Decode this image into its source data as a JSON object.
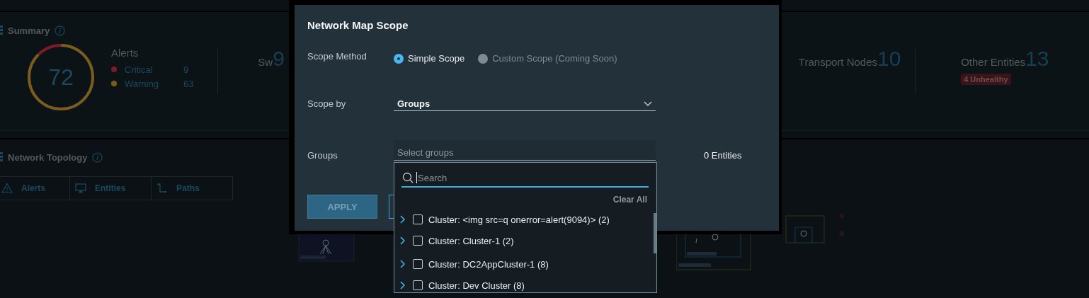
{
  "summary": {
    "title": "Summary",
    "alerts": {
      "title": "Alerts",
      "total": "72",
      "items": [
        {
          "label": "Critical",
          "count": "9",
          "color": "#7d1b27"
        },
        {
          "label": "Warning",
          "count": "63",
          "color": "#7a5c1e"
        }
      ]
    },
    "stats": [
      {
        "label": "Sw",
        "value": "9"
      },
      {
        "label": "Transport Nodes",
        "value": "10"
      },
      {
        "label": "Other Entities",
        "value": "13",
        "badge": "4 Unhealthy"
      }
    ]
  },
  "topology": {
    "title": "Network Topology",
    "tabs": [
      {
        "label": "Alerts"
      },
      {
        "label": "Entities"
      },
      {
        "label": "Paths"
      }
    ]
  },
  "modal": {
    "title": "Network Map Scope",
    "scope_method": {
      "label": "Scope Method",
      "options": [
        {
          "label": "Simple Scope",
          "selected": true,
          "disabled": false
        },
        {
          "label": "Custom Scope (Coming Soon)",
          "selected": false,
          "disabled": true
        }
      ]
    },
    "scope_by": {
      "label": "Scope by",
      "value": "Groups"
    },
    "groups": {
      "label": "Groups",
      "placeholder": "Select groups",
      "entity_count": "0 Entities"
    },
    "buttons": [
      {
        "label": "APPLY",
        "kind": "primary"
      },
      {
        "kind": "secondary"
      }
    ]
  },
  "dropdown": {
    "search": {
      "placeholder": "Search"
    },
    "clear_all": "Clear All",
    "items": [
      {
        "label": "Cluster: <img src=q onerror=alert(9094)> (2)",
        "expanded": false,
        "checked": false
      },
      {
        "label": "Cluster: Cluster-1 (2)",
        "expanded": false,
        "checked": false
      },
      {
        "label": "Cluster: DC2AppCluster-1 (8)",
        "expanded": false,
        "checked": false
      },
      {
        "label": "Cluster: Dev Cluster (8)",
        "expanded": false,
        "checked": false
      }
    ]
  }
}
